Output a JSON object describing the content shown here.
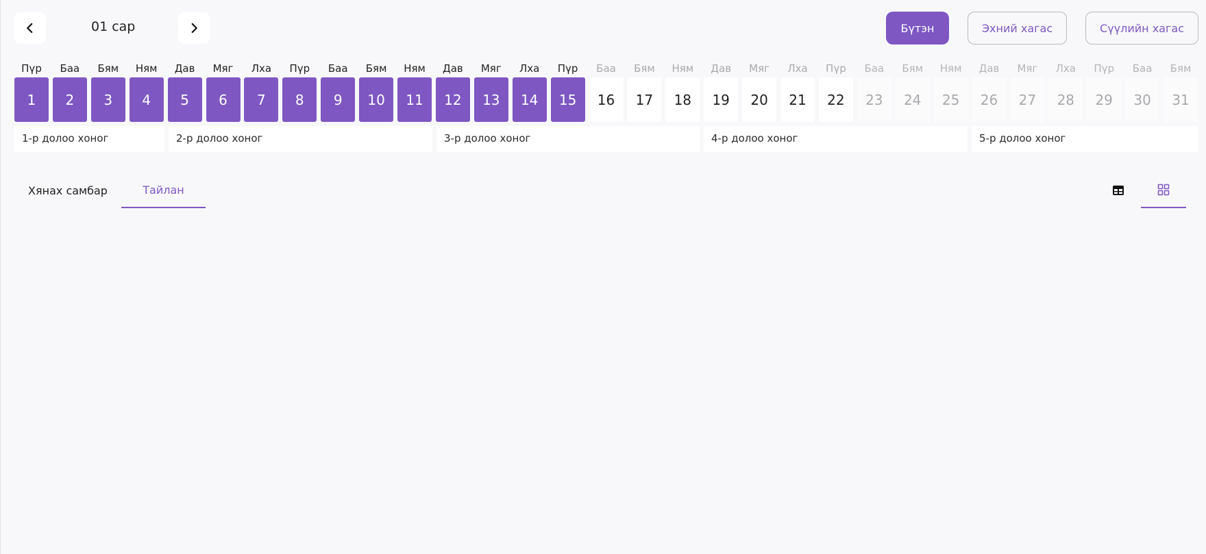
{
  "header": {
    "month_label": "01 сар",
    "prev_icon": "chevron-left-icon",
    "next_icon": "chevron-right-icon"
  },
  "range_buttons": {
    "full": "Бүтэн",
    "first_half": "Эхний хагас",
    "second_half": "Сүүлийн хагас"
  },
  "days": [
    {
      "name": "Пүр",
      "num": "1",
      "state": "selected"
    },
    {
      "name": "Баа",
      "num": "2",
      "state": "selected"
    },
    {
      "name": "Бям",
      "num": "3",
      "state": "selected"
    },
    {
      "name": "Ням",
      "num": "4",
      "state": "selected"
    },
    {
      "name": "Дав",
      "num": "5",
      "state": "selected"
    },
    {
      "name": "Мяг",
      "num": "6",
      "state": "selected"
    },
    {
      "name": "Лха",
      "num": "7",
      "state": "selected"
    },
    {
      "name": "Пүр",
      "num": "8",
      "state": "selected"
    },
    {
      "name": "Баа",
      "num": "9",
      "state": "selected"
    },
    {
      "name": "Бям",
      "num": "10",
      "state": "selected"
    },
    {
      "name": "Ням",
      "num": "11",
      "state": "selected"
    },
    {
      "name": "Дав",
      "num": "12",
      "state": "selected"
    },
    {
      "name": "Мяг",
      "num": "13",
      "state": "selected"
    },
    {
      "name": "Лха",
      "num": "14",
      "state": "selected"
    },
    {
      "name": "Пүр",
      "num": "15",
      "state": "selected"
    },
    {
      "name": "Баа",
      "num": "16",
      "state": "normal"
    },
    {
      "name": "Бям",
      "num": "17",
      "state": "normal"
    },
    {
      "name": "Ням",
      "num": "18",
      "state": "normal"
    },
    {
      "name": "Дав",
      "num": "19",
      "state": "normal"
    },
    {
      "name": "Мяг",
      "num": "20",
      "state": "normal"
    },
    {
      "name": "Лха",
      "num": "21",
      "state": "normal"
    },
    {
      "name": "Пүр",
      "num": "22",
      "state": "normal"
    },
    {
      "name": "Баа",
      "num": "23",
      "state": "muted"
    },
    {
      "name": "Бям",
      "num": "24",
      "state": "muted"
    },
    {
      "name": "Ням",
      "num": "25",
      "state": "muted"
    },
    {
      "name": "Дав",
      "num": "26",
      "state": "muted"
    },
    {
      "name": "Мяг",
      "num": "27",
      "state": "muted"
    },
    {
      "name": "Лха",
      "num": "28",
      "state": "muted"
    },
    {
      "name": "Пүр",
      "num": "29",
      "state": "muted"
    },
    {
      "name": "Баа",
      "num": "30",
      "state": "muted"
    },
    {
      "name": "Бям",
      "num": "31",
      "state": "muted"
    }
  ],
  "weeks": [
    {
      "label": "1-р долоо хоног"
    },
    {
      "label": "2-р долоо хоног"
    },
    {
      "label": "3-р долоо хоног"
    },
    {
      "label": "4-р долоо хоног"
    },
    {
      "label": "5-р долоо хоног"
    }
  ],
  "tabs": {
    "dashboard": "Хянах самбар",
    "report": "Тайлан",
    "active": "report"
  },
  "views": {
    "table_icon": "table-icon",
    "grid_icon": "grid-icon",
    "active": "grid"
  },
  "colors": {
    "accent": "#7e57c2",
    "background": "#f8f8fa"
  }
}
